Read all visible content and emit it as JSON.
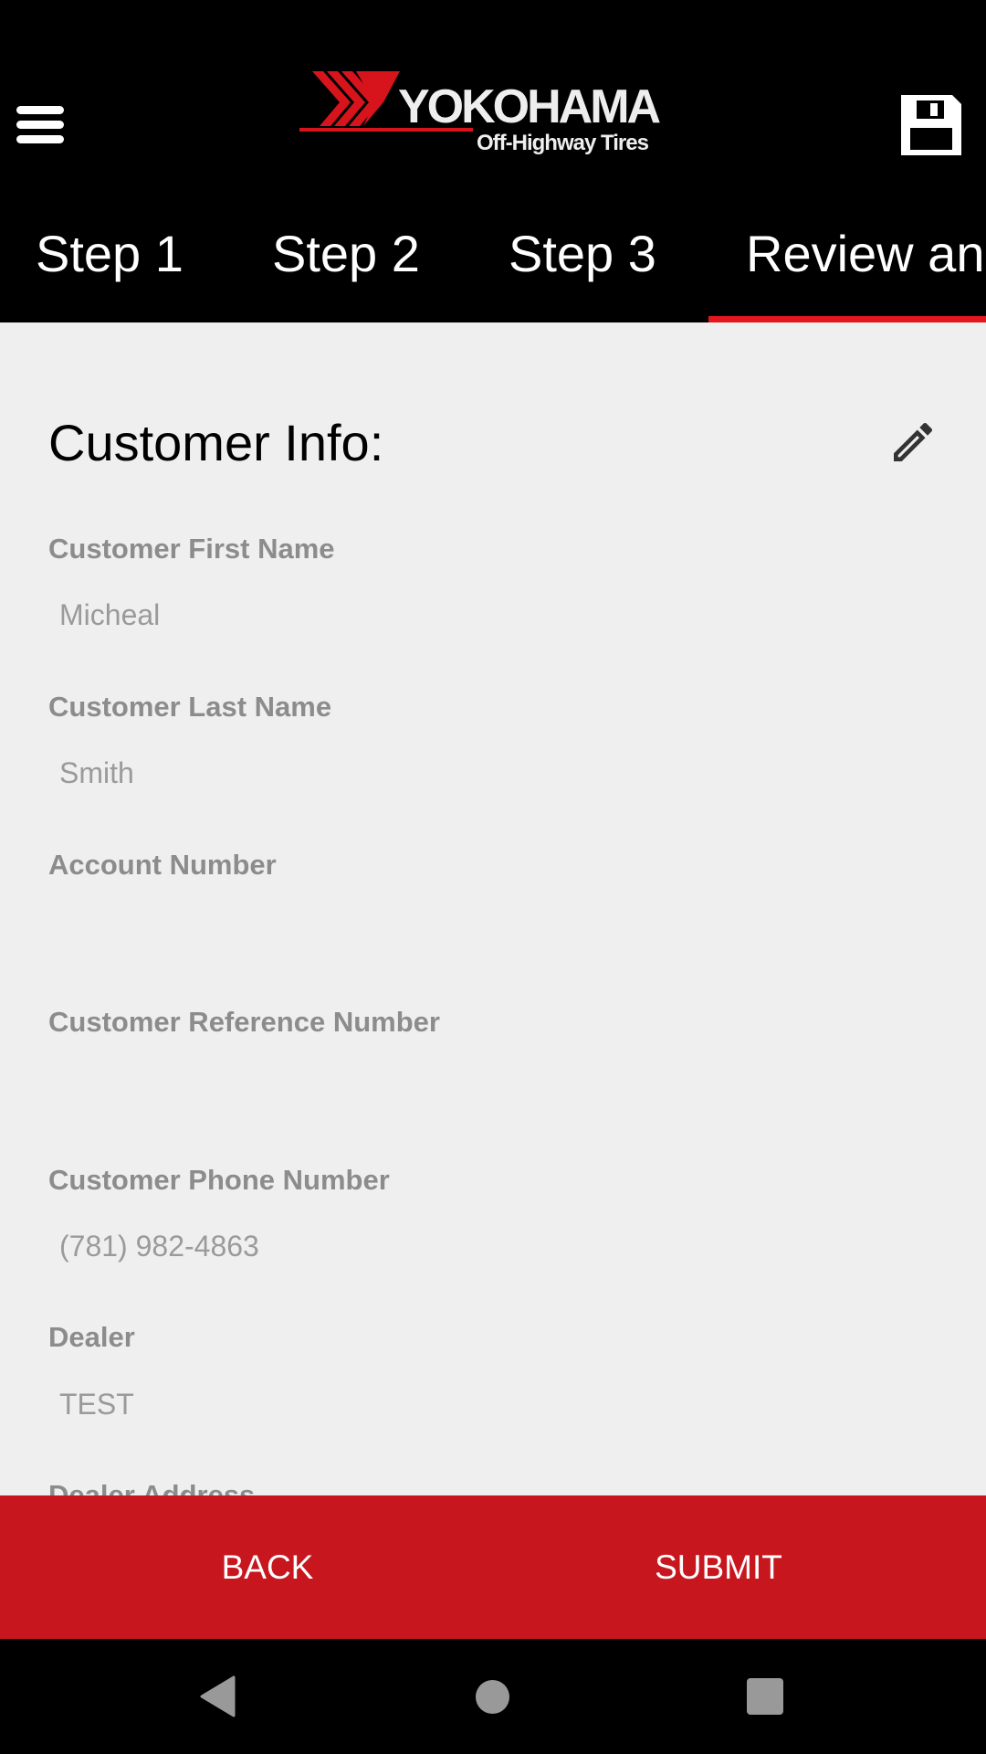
{
  "header": {
    "logo_text": "YOKOHAMA",
    "logo_subtitle": "Off-Highway Tires",
    "menu_icon": "hamburger-menu-icon",
    "save_icon": "floppy-disk-save-icon"
  },
  "tabs": [
    {
      "label": "Step 1",
      "active": false
    },
    {
      "label": "Step 2",
      "active": false
    },
    {
      "label": "Step 3",
      "active": false
    },
    {
      "label": "Review and",
      "active": true
    }
  ],
  "section": {
    "title": "Customer Info:",
    "edit_icon": "pencil-edit-icon"
  },
  "fields": [
    {
      "label": "Customer First Name",
      "value": "Micheal"
    },
    {
      "label": "Customer Last Name",
      "value": "Smith"
    },
    {
      "label": "Account Number",
      "value": ""
    },
    {
      "label": "Customer Reference Number",
      "value": ""
    },
    {
      "label": "Customer Phone Number",
      "value": "(781) 982-4863"
    },
    {
      "label": "Dealer",
      "value": "TEST"
    },
    {
      "label": "Dealer Address",
      "value": ""
    }
  ],
  "actions": {
    "back": "BACK",
    "submit": "SUBMIT"
  },
  "colors": {
    "accent": "#c8161f",
    "tab_indicator": "#e3151d",
    "header_bg": "#000000",
    "content_bg": "#efefef"
  }
}
